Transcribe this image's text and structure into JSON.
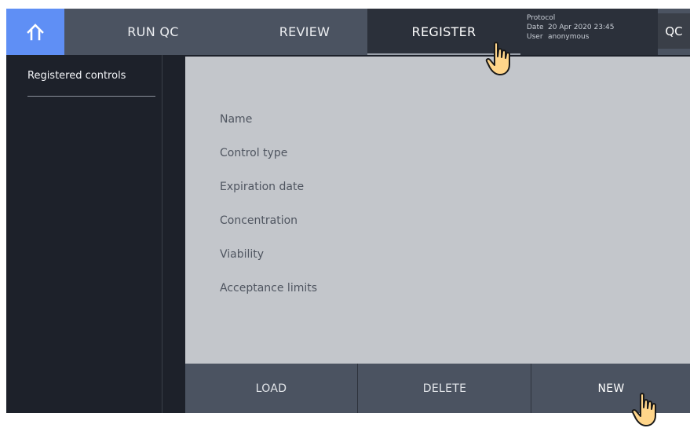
{
  "header": {
    "tabs": [
      {
        "label": "RUN QC",
        "active": false
      },
      {
        "label": "REVIEW",
        "active": false
      },
      {
        "label": "REGISTER",
        "active": true
      }
    ],
    "info": {
      "protocol_label": "Protocol",
      "protocol_value": "",
      "date_label": "Date",
      "date_value": "20 Apr 2020 23:45",
      "user_label": "User",
      "user_value": "anonymous"
    },
    "mode_label": "QC",
    "home_icon": "home-icon"
  },
  "sidebar": {
    "title": "Registered controls",
    "items": []
  },
  "details": {
    "fields": [
      {
        "label": "Name"
      },
      {
        "label": "Control type"
      },
      {
        "label": "Expiration date"
      },
      {
        "label": "Concentration"
      },
      {
        "label": "Viability"
      },
      {
        "label": "Acceptance limits"
      }
    ]
  },
  "actions": {
    "load_label": "LOAD",
    "delete_label": "DELETE",
    "new_label": "NEW"
  },
  "colors": {
    "accent": "#5f8ff5",
    "topbar": "#4b5361",
    "active_tab": "#2b303a",
    "background": "#1d212a",
    "panel": "#c3c6cb"
  }
}
